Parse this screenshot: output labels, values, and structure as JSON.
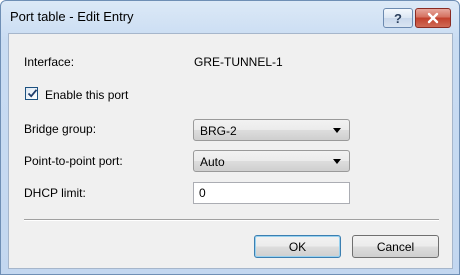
{
  "window": {
    "title": "Port table - Edit Entry",
    "help_label": "?"
  },
  "form": {
    "interface_label": "Interface:",
    "interface_value": "GRE-TUNNEL-1",
    "enable_label": "Enable this port",
    "enable_checked": true,
    "bridge_group_label": "Bridge group:",
    "bridge_group_value": "BRG-2",
    "p2p_label": "Point-to-point port:",
    "p2p_value": "Auto",
    "dhcp_label": "DHCP limit:",
    "dhcp_value": "0"
  },
  "buttons": {
    "ok_label": "OK",
    "cancel_label": "Cancel"
  },
  "colors": {
    "title_bar": "#c9dcf2",
    "close_button": "#c2402c",
    "dialog_background": "#f0f0f0"
  },
  "icons": {
    "help": "question-mark-icon",
    "close": "close-x-icon",
    "check": "checkmark-icon",
    "dropdown": "chevron-down-icon"
  }
}
